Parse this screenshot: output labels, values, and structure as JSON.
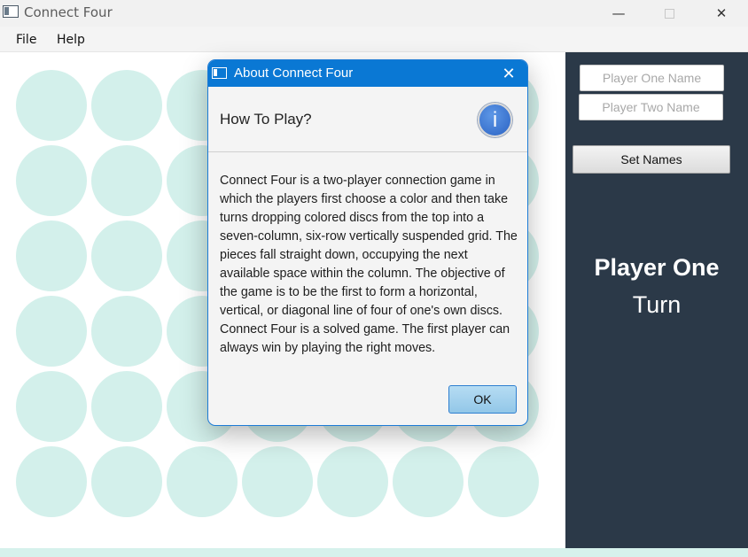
{
  "window": {
    "title": "Connect Four",
    "icon": "app-window-icon",
    "controls": {
      "minimize": "—",
      "maximize": "☐",
      "close": "✕"
    }
  },
  "menubar": {
    "items": [
      {
        "label": "File"
      },
      {
        "label": "Help"
      }
    ]
  },
  "board": {
    "columns": 7,
    "rows": 6,
    "empty_color": "#d3f0eb"
  },
  "sidebar": {
    "player_one_placeholder": "Player One Name",
    "player_two_placeholder": "Player Two Name",
    "player_one_value": "",
    "player_two_value": "",
    "set_names_label": "Set Names",
    "current_player": "Player One",
    "turn_label": "Turn",
    "background": "#2b3948"
  },
  "dialog": {
    "title": "About Connect Four",
    "close_glyph": "✕",
    "heading": "How To Play?",
    "info_icon": "info-icon",
    "info_glyph": "i",
    "body": "Connect Four is a two-player connection game in which the players first choose a color and then take turns dropping colored discs from the top into a seven-column, six-row vertically suspended grid. The pieces fall straight down, occupying the next available space within the column. The objective of the game is to be the first to form a horizontal, vertical, or diagonal line of four of one's own discs. Connect Four is a solved game. The first player can always win by playing the right moves.",
    "ok_label": "OK",
    "accent": "#0a78d4"
  }
}
